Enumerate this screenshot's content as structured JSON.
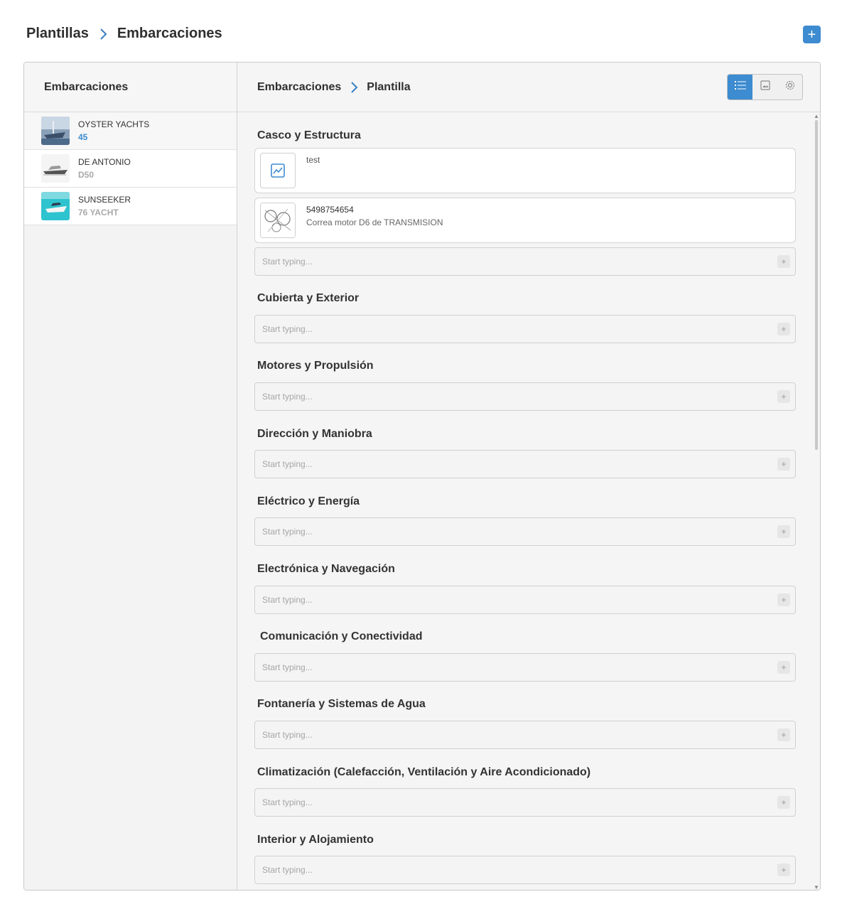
{
  "header": {
    "breadcrumb": [
      "Plantillas",
      "Embarcaciones"
    ],
    "add_button": "+"
  },
  "sidebar": {
    "title": "Embarcaciones",
    "boats": [
      {
        "name": "OYSTER YACHTS",
        "model": "45"
      },
      {
        "name": "DE ANTONIO",
        "model": "D50"
      },
      {
        "name": "SUNSEEKER",
        "model": "76 YACHT"
      }
    ]
  },
  "panel": {
    "breadcrumb": [
      "Embarcaciones",
      "Plantilla"
    ],
    "view_icons": [
      "list-icon",
      "image-icon",
      "gear-icon"
    ],
    "placeholder": "Start typing...",
    "plus": "+",
    "sections": [
      {
        "title": "Casco y Estructura",
        "items": [
          {
            "line1": "test",
            "line2": ""
          },
          {
            "line1": "5498754654",
            "line2": "Correa motor D6 de TRANSMISION"
          }
        ]
      },
      {
        "title": "Cubierta y Exterior"
      },
      {
        "title": "Motores y Propulsión"
      },
      {
        "title": "Dirección y Maniobra"
      },
      {
        "title": "Eléctrico y Energía"
      },
      {
        "title": "Electrónica y Navegación"
      },
      {
        "title": "Comunicación y Conectividad"
      },
      {
        "title": "Fontanería y Sistemas de Agua"
      },
      {
        "title": "Climatización (Calefacción, Ventilación y Aire Acondicionado)"
      },
      {
        "title": "Interior y Alojamiento"
      }
    ]
  },
  "colors": {
    "accent": "#3d8bd0"
  }
}
